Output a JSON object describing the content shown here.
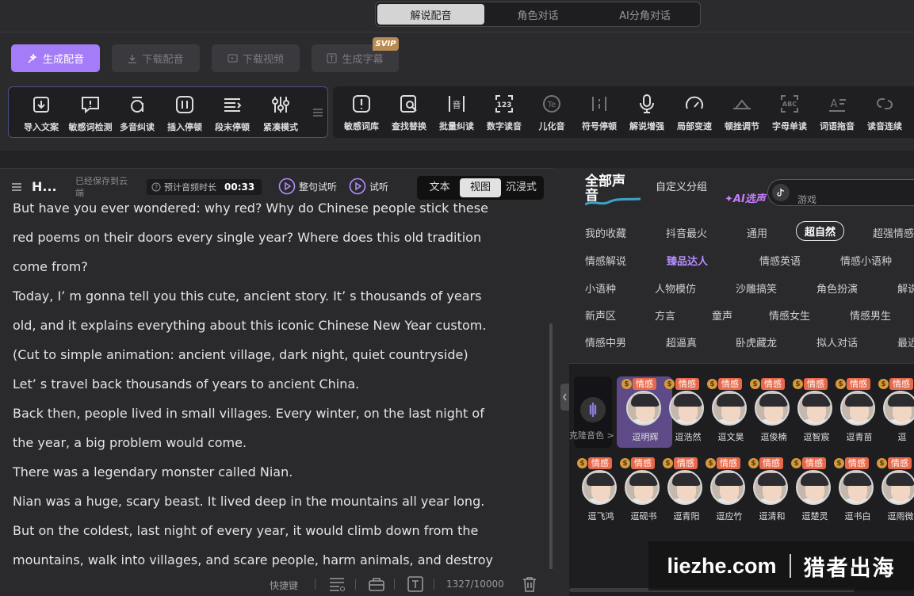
{
  "mode_tabs": [
    "解说配音",
    "角色对话",
    "AI分角对话"
  ],
  "actions": {
    "generate": "生成配音",
    "download_audio": "下载配音",
    "download_video": "下载视频",
    "subtitle": "生成字幕",
    "svip": "SVIP"
  },
  "toolbar_left": [
    "导入文案",
    "敏感词检测",
    "多音纠读",
    "插入停顿",
    "段末停顿",
    "紧凑模式"
  ],
  "toolbar_right": [
    "敏感词库",
    "查找替换",
    "批量纠读",
    "数字读音",
    "儿化音",
    "符号停顿",
    "解说增强",
    "局部变速",
    "顿挫调节",
    "字母单读",
    "词语拖音",
    "读音连续"
  ],
  "editor": {
    "title": "H...",
    "save_status": "已经保存到云端",
    "duration_label": "预计音频时长",
    "duration_value": "00:33",
    "try_sentence": "整句试听",
    "try_one": "试听",
    "view_modes": [
      "文本",
      "视图",
      "沉浸式"
    ],
    "lines": [
      "But have you ever wondered: why red? Why do Chinese people stick these",
      "red poems on their doors every single year? Where does this old tradition",
      "come from?",
      "Today, I’ m gonna tell you this cute, ancient story. It’ s thousands of years",
      "old, and it explains everything about this iconic Chinese New Year custom.",
      "(Cut to simple animation: ancient village, dark night, quiet countryside)",
      "Let’ s travel back thousands of years to ancient China.",
      "Back then, people lived in small villages. Every winter, on the last night of",
      "the year, a big problem would come.",
      "There was a legendary monster called Nian.",
      "Nian was a huge, scary beast. It lived deep in the mountains all year long.",
      "But on the coldest, last night of every year, it would climb down from the",
      "mountains, walk into villages, and scare people, harm animals, and destroy"
    ],
    "shortcut": "快捷键",
    "char_count": "1327/10000"
  },
  "voice": {
    "all": "全部声音",
    "custom": "自定义分组",
    "ai_select": "AI选声",
    "search_label": "游戏",
    "categories": [
      [
        "我的收藏",
        "抖音最火",
        "通用",
        "超自然",
        "超强情感"
      ],
      [
        "情感解说",
        "臻品达人",
        "情感英语",
        "情感小语种"
      ],
      [
        "小语种",
        "人物模仿",
        "沙雕搞笑",
        "角色扮演",
        "解说"
      ],
      [
        "新声区",
        "方言",
        "童声",
        "情感女生",
        "情感男生"
      ],
      [
        "情感中男",
        "超逼真",
        "卧虎藏龙",
        "拟人对话",
        "最近"
      ]
    ],
    "selected_category": "超自然",
    "clone_label": "克隆音色 >",
    "emotion_tag": "情感",
    "coin": "$",
    "row1": [
      "逗明辉",
      "逗浩然",
      "逗文昊",
      "逗俊楠",
      "逗智宸",
      "逗青苗",
      "逗"
    ],
    "row2": [
      "逗飞鸿",
      "逗砚书",
      "逗青阳",
      "逗应竹",
      "逗清和",
      "逗楚灵",
      "逗书白",
      "逗雨微"
    ]
  },
  "watermark": {
    "left": "liezhe.com",
    "right": "猎者出海"
  },
  "colors": {
    "accent": "#a57cf7",
    "emotion_tag": "#e8684a",
    "coin": "#d59a3d"
  }
}
